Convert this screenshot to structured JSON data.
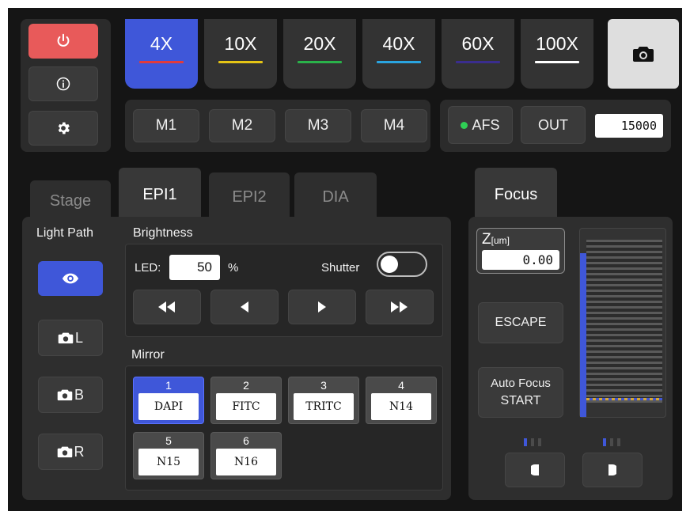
{
  "objectives": [
    {
      "label": "4X",
      "color": "#e23b3b",
      "active": true
    },
    {
      "label": "10X",
      "color": "#e5c415",
      "active": false
    },
    {
      "label": "20X",
      "color": "#2ab24a",
      "active": false
    },
    {
      "label": "40X",
      "color": "#2aa4e0",
      "active": false
    },
    {
      "label": "60X",
      "color": "#3a2d8f",
      "active": false
    },
    {
      "label": "100X",
      "color": "#ffffff",
      "active": false
    }
  ],
  "memory": [
    "M1",
    "M2",
    "M3",
    "M4"
  ],
  "afs": {
    "label": "AFS",
    "out_label": "OUT",
    "value": "15000"
  },
  "tabs": [
    "Stage",
    "EPI1",
    "EPI2",
    "DIA"
  ],
  "focus_tab": "Focus",
  "light_path": {
    "title": "Light Path",
    "buttons": [
      "L",
      "B",
      "R"
    ]
  },
  "brightness": {
    "title": "Brightness",
    "led_label": "LED:",
    "led_value": "50",
    "unit": "%",
    "shutter_label": "Shutter"
  },
  "mirror": {
    "title": "Mirror",
    "items": [
      {
        "idx": "1",
        "name": "DAPI"
      },
      {
        "idx": "2",
        "name": "FITC"
      },
      {
        "idx": "3",
        "name": "TRITC"
      },
      {
        "idx": "4",
        "name": "N14"
      },
      {
        "idx": "5",
        "name": "N15"
      },
      {
        "idx": "6",
        "name": "N16"
      }
    ]
  },
  "focus": {
    "z_label": "Z",
    "z_unit": "[um]",
    "z_value": "0.00",
    "escape": "ESCAPE",
    "autofocus_line1": "Auto Focus",
    "autofocus_line2": "START",
    "level_fraction": 0.95
  },
  "colors": {
    "accent": "#3f57d9",
    "power": "#e85a5a",
    "afs_on": "#2fcf55"
  }
}
